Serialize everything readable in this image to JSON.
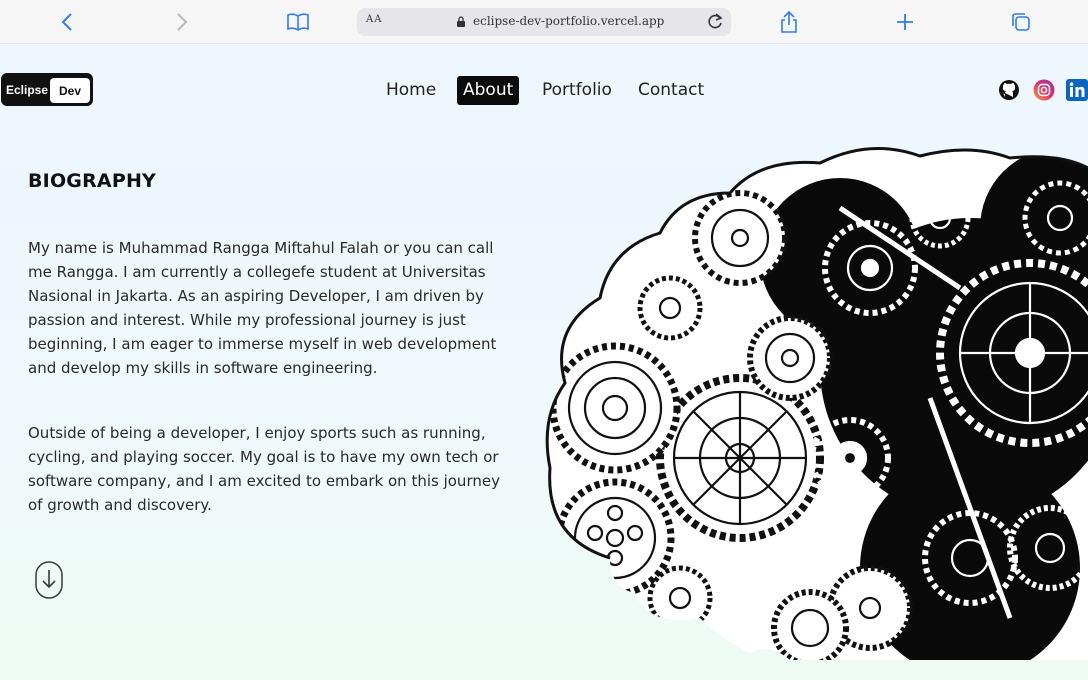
{
  "browser": {
    "aa_label": "AA",
    "url": "eclipse-dev-portfolio.vercel.app"
  },
  "logo": {
    "part1": "Eclipse",
    "part2": "Dev"
  },
  "nav": {
    "items": [
      {
        "label": "Home"
      },
      {
        "label": "About"
      },
      {
        "label": "Portfolio"
      },
      {
        "label": "Contact"
      }
    ],
    "active": "About"
  },
  "social": [
    "github-icon",
    "instagram-icon",
    "linkedin-icon"
  ],
  "biography": {
    "title": "BIOGRAPHY",
    "paragraph1": "My name is Muhammad Rangga Miftahul Falah or you can call me Rangga. I am currently a collegefe student at Universitas Nasional in Jakarta. As an aspiring Developer, I am driven by passion and interest. While my professional journey is just beginning, I am eager to immerse myself in web development and develop my skills in software engineering.",
    "paragraph2": "Outside of being a developer, I enjoy sports such as running, cycling, and playing soccer. My goal is to have my own tech or software company, and I am excited to embark on this journey of growth and discovery."
  },
  "colors": {
    "accent": "#0b0b0b",
    "instagram": "#c13584",
    "linkedin": "#0a66c2"
  }
}
